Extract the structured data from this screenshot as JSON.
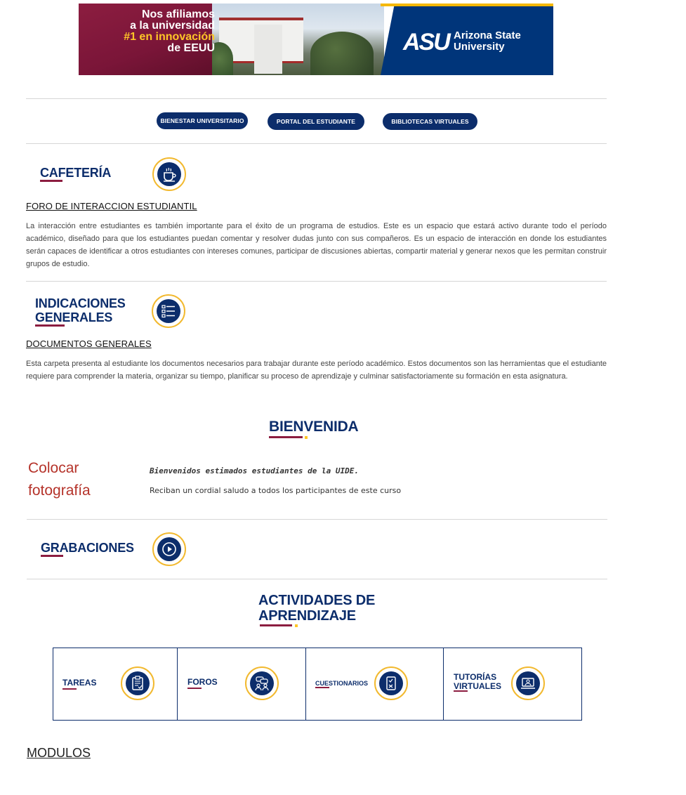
{
  "banner": {
    "line1": "Nos afiliamos",
    "line2": "a la universidad",
    "line3": "#1 en innovación",
    "line4": "de EEUU",
    "logo_mark": "ASU",
    "logo_name_1": "Arizona State",
    "logo_name_2": "University",
    "colors": {
      "maroon": "#8c1d40",
      "gold": "#ffc627",
      "blue": "#00357a"
    }
  },
  "nav": {
    "buttons": [
      {
        "label": "BIENESTAR UNIVERSITARIO"
      },
      {
        "label": "PORTAL DEL ESTUDIANTE"
      },
      {
        "label": "BIBLIOTECAS VIRTUALES"
      }
    ]
  },
  "cafeteria": {
    "title": "CAFETERÍA",
    "icon": "coffee-cup-icon",
    "link": "FORO DE INTERACCION ESTUDIANTIL ",
    "text": "La interacción entre estudiantes es también importante para el éxito de un programa de estudios. Este es un espacio que estará activo durante todo el período académico, diseñado para que los estudiantes puedan comentar y resolver dudas junto con sus compañeros. Es un espacio de interacción en donde los estudiantes serán capaces de identificar a otros estudiantes con intereses comunes, participar de discusiones abiertas, compartir material y generar nexos que les permitan construir grupos de estudio."
  },
  "indicaciones": {
    "title_1": "INDICACIONES",
    "title_2": "GENERALES",
    "icon": "list-icon",
    "link": "DOCUMENTOS GENERALES ",
    "text": "Esta carpeta presenta al estudiante los documentos necesarios para trabajar durante este período académico. Estos documentos son las herramientas que el estudiante requiere para comprender la materia, organizar su tiempo, planificar su proceso de aprendizaje y culminar satisfactoriamente su formación en esta asignatura."
  },
  "bienvenida": {
    "title": "BIENVENIDA",
    "placeholder_1": "Colocar",
    "placeholder_2": "fotografía",
    "greeting": "Bienvenidos estimados estudiantes de la UIDE.",
    "message": "Reciban un cordial saludo a todos los participantes de este curso"
  },
  "grabaciones": {
    "title": "GRABACIONES",
    "icon": "play-icon"
  },
  "actividades": {
    "title_1": "ACTIVIDADES DE",
    "title_2": "APRENDIZAJE",
    "items": [
      {
        "label_1": "TAREAS",
        "label_2": "",
        "icon": "clipboard-icon"
      },
      {
        "label_1": "FOROS",
        "label_2": "",
        "icon": "chat-people-icon"
      },
      {
        "label_1": "CUESTIONARIOS",
        "label_2": "",
        "icon": "quiz-checklist-icon"
      },
      {
        "label_1": "TUTORÍAS",
        "label_2": "VIRTUALES",
        "icon": "laptop-tutor-icon"
      }
    ]
  },
  "modulos": {
    "label": "MODULOS"
  }
}
